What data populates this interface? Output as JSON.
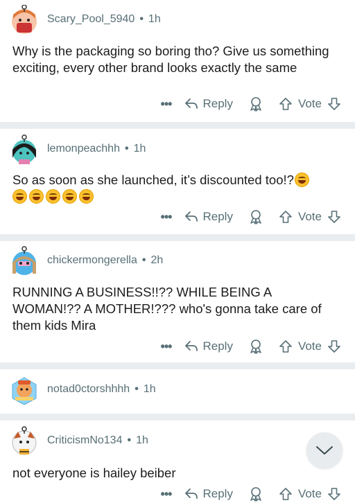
{
  "comments": [
    {
      "username": "Scary_Pool_5940",
      "time": "1h",
      "text": "Why is the packaging so boring tho? Give us something exciting, every other brand looks exactly the same",
      "reply_label": "Reply",
      "vote_label": "Vote"
    },
    {
      "username": "lemonpeachhh",
      "time": "1h",
      "text": "So as soon as she launched, it’s discounted too!?",
      "emoji_count": 6,
      "reply_label": "Reply",
      "vote_label": "Vote"
    },
    {
      "username": "chickermongerella",
      "time": "2h",
      "text": "RUNNING A BUSINESS!!?? WHILE BEING A WOMAN!?? A MOTHER!??? who's gonna take care of them kids Mira",
      "reply_label": "Reply",
      "vote_label": "Vote"
    },
    {
      "username": "notad0ctorshhhh",
      "time": "1h"
    },
    {
      "username": "CriticismNo134",
      "time": "1h",
      "text": "not everyone is hailey beiber",
      "reply_label": "Reply",
      "vote_label": "Vote"
    }
  ],
  "more_label": "•••",
  "dot": "•",
  "colors": {
    "meta_gray": "#576f76",
    "divider": "#eaedef",
    "text": "#1c1c1c",
    "fab_bg": "#e9ecee"
  },
  "icons": [
    "reply-arrow-icon",
    "award-icon",
    "upvote-arrow-icon",
    "downvote-arrow-icon",
    "more-dots-icon",
    "chevron-down-icon",
    "rolling-laughing-emoji"
  ]
}
